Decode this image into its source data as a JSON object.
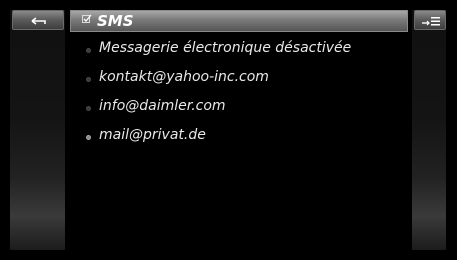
{
  "header": {
    "title": "SMS"
  },
  "buttons": {
    "back_icon": "back-arrow-icon",
    "menu_icon": "menu-list-icon"
  },
  "list": {
    "items": [
      {
        "label": "Messagerie électronique désactivée",
        "selected": false
      },
      {
        "label": "kontakt@yahoo-inc.com",
        "selected": false
      },
      {
        "label": "info@daimler.com",
        "selected": false
      },
      {
        "label": "mail@privat.de",
        "selected": true
      }
    ]
  },
  "colors": {
    "background": "#000000",
    "text": "#e8e8e8",
    "title_bar": "#7a7a7a"
  }
}
